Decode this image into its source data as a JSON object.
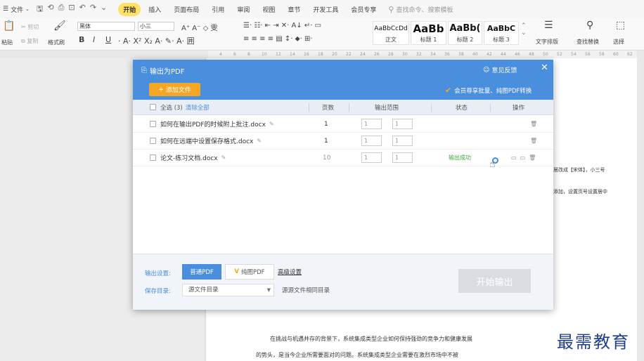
{
  "menubar": {
    "file": "文件",
    "tabs": [
      "开始",
      "插入",
      "页面布局",
      "引用",
      "审阅",
      "视图",
      "章节",
      "开发工具",
      "会员专享"
    ],
    "active_tab": "开始",
    "search_placeholder": "查找命令、搜索模板"
  },
  "ribbon": {
    "cut": "剪切",
    "copy": "复制",
    "paste": "粘贴",
    "format_painter": "格式刷",
    "font_name": "黑体",
    "font_size": "小三",
    "styles": [
      {
        "preview": "AaBbCcDd",
        "label": "正文"
      },
      {
        "preview": "AaBb",
        "label": "标题 1"
      },
      {
        "preview": "AaBb(",
        "label": "标题 2"
      },
      {
        "preview": "AaBbC",
        "label": "标题 3"
      }
    ],
    "text_layout": "文字排版",
    "find_replace": "查找替换",
    "select": "选择"
  },
  "ruler": [
    "4",
    "6",
    "8",
    "10",
    "12",
    "14",
    "16",
    "18",
    "20",
    "22",
    "24",
    "26",
    "28",
    "30",
    "32",
    "34",
    "36",
    "38",
    "40",
    "42",
    "44",
    "46",
    "48",
    "50",
    "52",
    "54",
    "56",
    "58",
    "60",
    "62"
  ],
  "dialog": {
    "title": "输出为PDF",
    "feedback": "意见反馈",
    "add_file": "添加文件",
    "member_note": "会员尊享批量、纯图PDF转换",
    "header": {
      "select_all": "全选 (3)",
      "clear_all": "清除全部",
      "pages": "页数",
      "range": "输出范围",
      "status": "状态",
      "ops": "操作"
    },
    "files": [
      {
        "name": "如何在输出PDF的时候附上批注.docx",
        "pages": "1",
        "from": "1",
        "to": "1",
        "status": ""
      },
      {
        "name": "如何在远端中设置保存格式.docx",
        "pages": "1",
        "from": "1",
        "to": "1",
        "status": ""
      },
      {
        "name": "论文-练习文档.docx",
        "pages": "10",
        "from": "1",
        "to": "1",
        "status": "输出成功"
      }
    ],
    "footer": {
      "output_settings": "输出设置:",
      "normal_pdf": "普通PDF",
      "pure_pdf": "纯图PDF",
      "advanced": "高级设置",
      "save_dir_label": "保存目录:",
      "save_dir": "源文件目录",
      "same_dir": "源源文件相同目录",
      "start": "开始输出"
    }
  },
  "document": {
    "side_text_1": "居改成【宋体】，小三号",
    "side_text_2": "添加，设置页号设置居中",
    "body_line_1": "在挑战与机遇并存的背景下，系统集成类型企业如何保持强劲的竞争力和健康发展",
    "body_line_2": "的势头，是当今企业所需要面对的问题。系统集成类型企业需要在激烈市场中不被"
  },
  "watermark": "最需教育",
  "colors": {
    "dialog_blue": "#4a8ede",
    "add_orange": "#f5a623",
    "success_green": "#3aaa35",
    "watermark_blue": "#1f3e91"
  }
}
